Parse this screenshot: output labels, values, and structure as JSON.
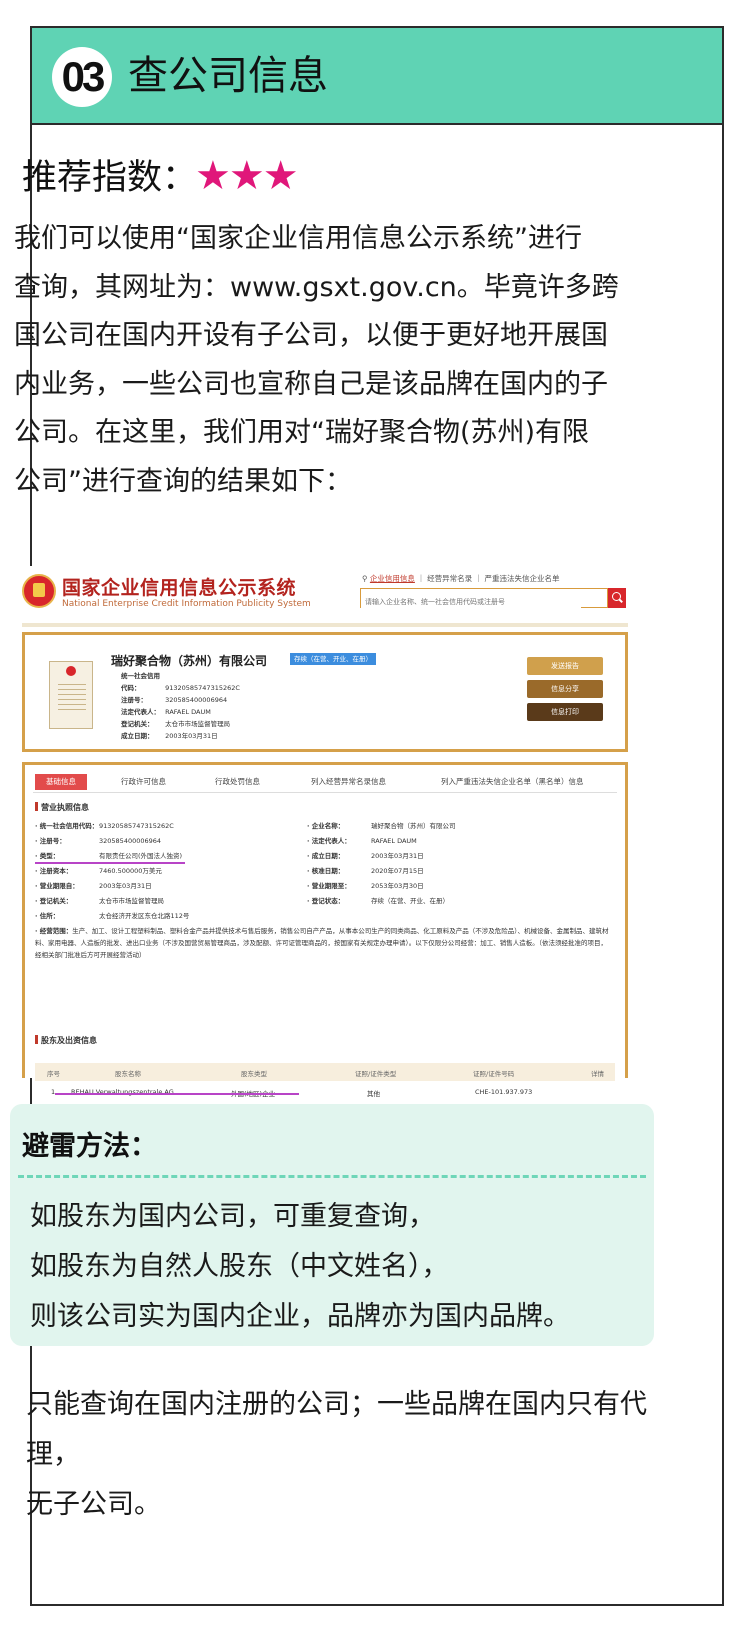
{
  "header": {
    "number": "03",
    "title": "查公司信息"
  },
  "rating": {
    "label": "推荐指数：",
    "stars": "★★★",
    "star_color": "#e0177a"
  },
  "intro": {
    "lines": [
      "我们可以使用“国家企业信用信息公示系统”进行",
      "查询，其网址为：www.gsxt.gov.cn。毕竟许多跨",
      "国公司在国内开设有子公司，以便于更好地开展国",
      "内业务，一些公司也宣称自己是该品牌在国内的子",
      "公司。在这里，我们用对“瑞好聚合物(苏州)有限",
      "公司”进行查询的结果如下："
    ]
  },
  "screenshot": {
    "site_title": "国家企业信用信息公示系统",
    "site_subtitle": "National Enterprise Credit Information Publicity System",
    "links": [
      "企业信用信息",
      "经营异常名录",
      "严重违法失信企业名单"
    ],
    "search_placeholder": "请输入企业名称、统一社会信用代码或注册号",
    "company": {
      "name": "瑞好聚合物（苏州）有限公司",
      "status": "存续（在营、开业、在册）",
      "fields": [
        {
          "k": "统一社会信用代码：",
          "v": "91320585747315262C"
        },
        {
          "k": "注册号：",
          "v": "320585400006964"
        },
        {
          "k": "法定代表人：",
          "v": "RAFAEL DAUM"
        },
        {
          "k": "登记机关：",
          "v": "太仓市市场监督管理局"
        },
        {
          "k": "成立日期：",
          "v": "2003年03月31日"
        }
      ],
      "buttons": [
        "发送报告",
        "信息分享",
        "信息打印"
      ]
    },
    "tabs": [
      "基础信息",
      "行政许可信息",
      "行政处罚信息",
      "列入经营异常名录信息",
      "列入严重违法失信企业名单（黑名单）信息"
    ],
    "license_section": "营业执照信息",
    "left_fields": [
      {
        "k": "· 统一社会信用代码：",
        "v": "91320585747315262C"
      },
      {
        "k": "· 注册号：",
        "v": "320585400006964"
      },
      {
        "k": "· 类型：",
        "v": "有限责任公司(外国法人独资)"
      },
      {
        "k": "· 注册资本：",
        "v": "7460.500000万美元"
      },
      {
        "k": "· 营业期限自：",
        "v": "2003年03月31日"
      },
      {
        "k": "· 登记机关：",
        "v": "太仓市市场监督管理局"
      },
      {
        "k": "· 住所：",
        "v": "太仓经济开发区东仓北路112号"
      }
    ],
    "right_fields": [
      {
        "k": "· 企业名称：",
        "v": "瑞好聚合物（苏州）有限公司"
      },
      {
        "k": "· 法定代表人：",
        "v": "RAFAEL DAUM"
      },
      {
        "k": "· 成立日期：",
        "v": "2003年03月31日"
      },
      {
        "k": "· 核准日期：",
        "v": "2020年07月15日"
      },
      {
        "k": "· 营业期限至：",
        "v": "2053年03月30日"
      },
      {
        "k": "· 登记状态：",
        "v": "存续（在营、开业、在册）"
      }
    ],
    "scope_label": "· 经营范围：",
    "scope_text": "生产、加工、设计工程塑料制品、塑料合金产品并提供技术与售后服务，销售公司自产产品，从事本公司生产的同类商品、化工原料及产品（不涉及危险品）、机械设备、金属制品、建筑材料、家用电器、人造板的批发、进出口业务（不涉及国营贸易管理商品，涉及配额、许可证管理商品的，按国家有关规定办理申请）。以下仅限分公司经营：加工、销售人造板。（依法须经批准的项目，经相关部门批准后方可开展经营活动）",
    "shareholder_section": "股东及出资信息",
    "table_headers": [
      "序号",
      "股东名称",
      "股东类型",
      "证照/证件类型",
      "证照/证件号码",
      "详情"
    ],
    "table_row": [
      "1",
      "REHAU Verwaltungszentrale AG",
      "外国(地区)企业",
      "其他",
      "CHE-101.937.973",
      ""
    ]
  },
  "tips": {
    "title": "避雷方法：",
    "lines": [
      "如股东为国内公司，可重复查询，",
      "如股东为自然人股东（中文姓名），",
      "则该公司实为国内企业，品牌亦为国内品牌。"
    ]
  },
  "note": {
    "lines": [
      "只能查询在国内注册的公司；一些品牌在国内只有代理，",
      "无子公司。"
    ]
  }
}
